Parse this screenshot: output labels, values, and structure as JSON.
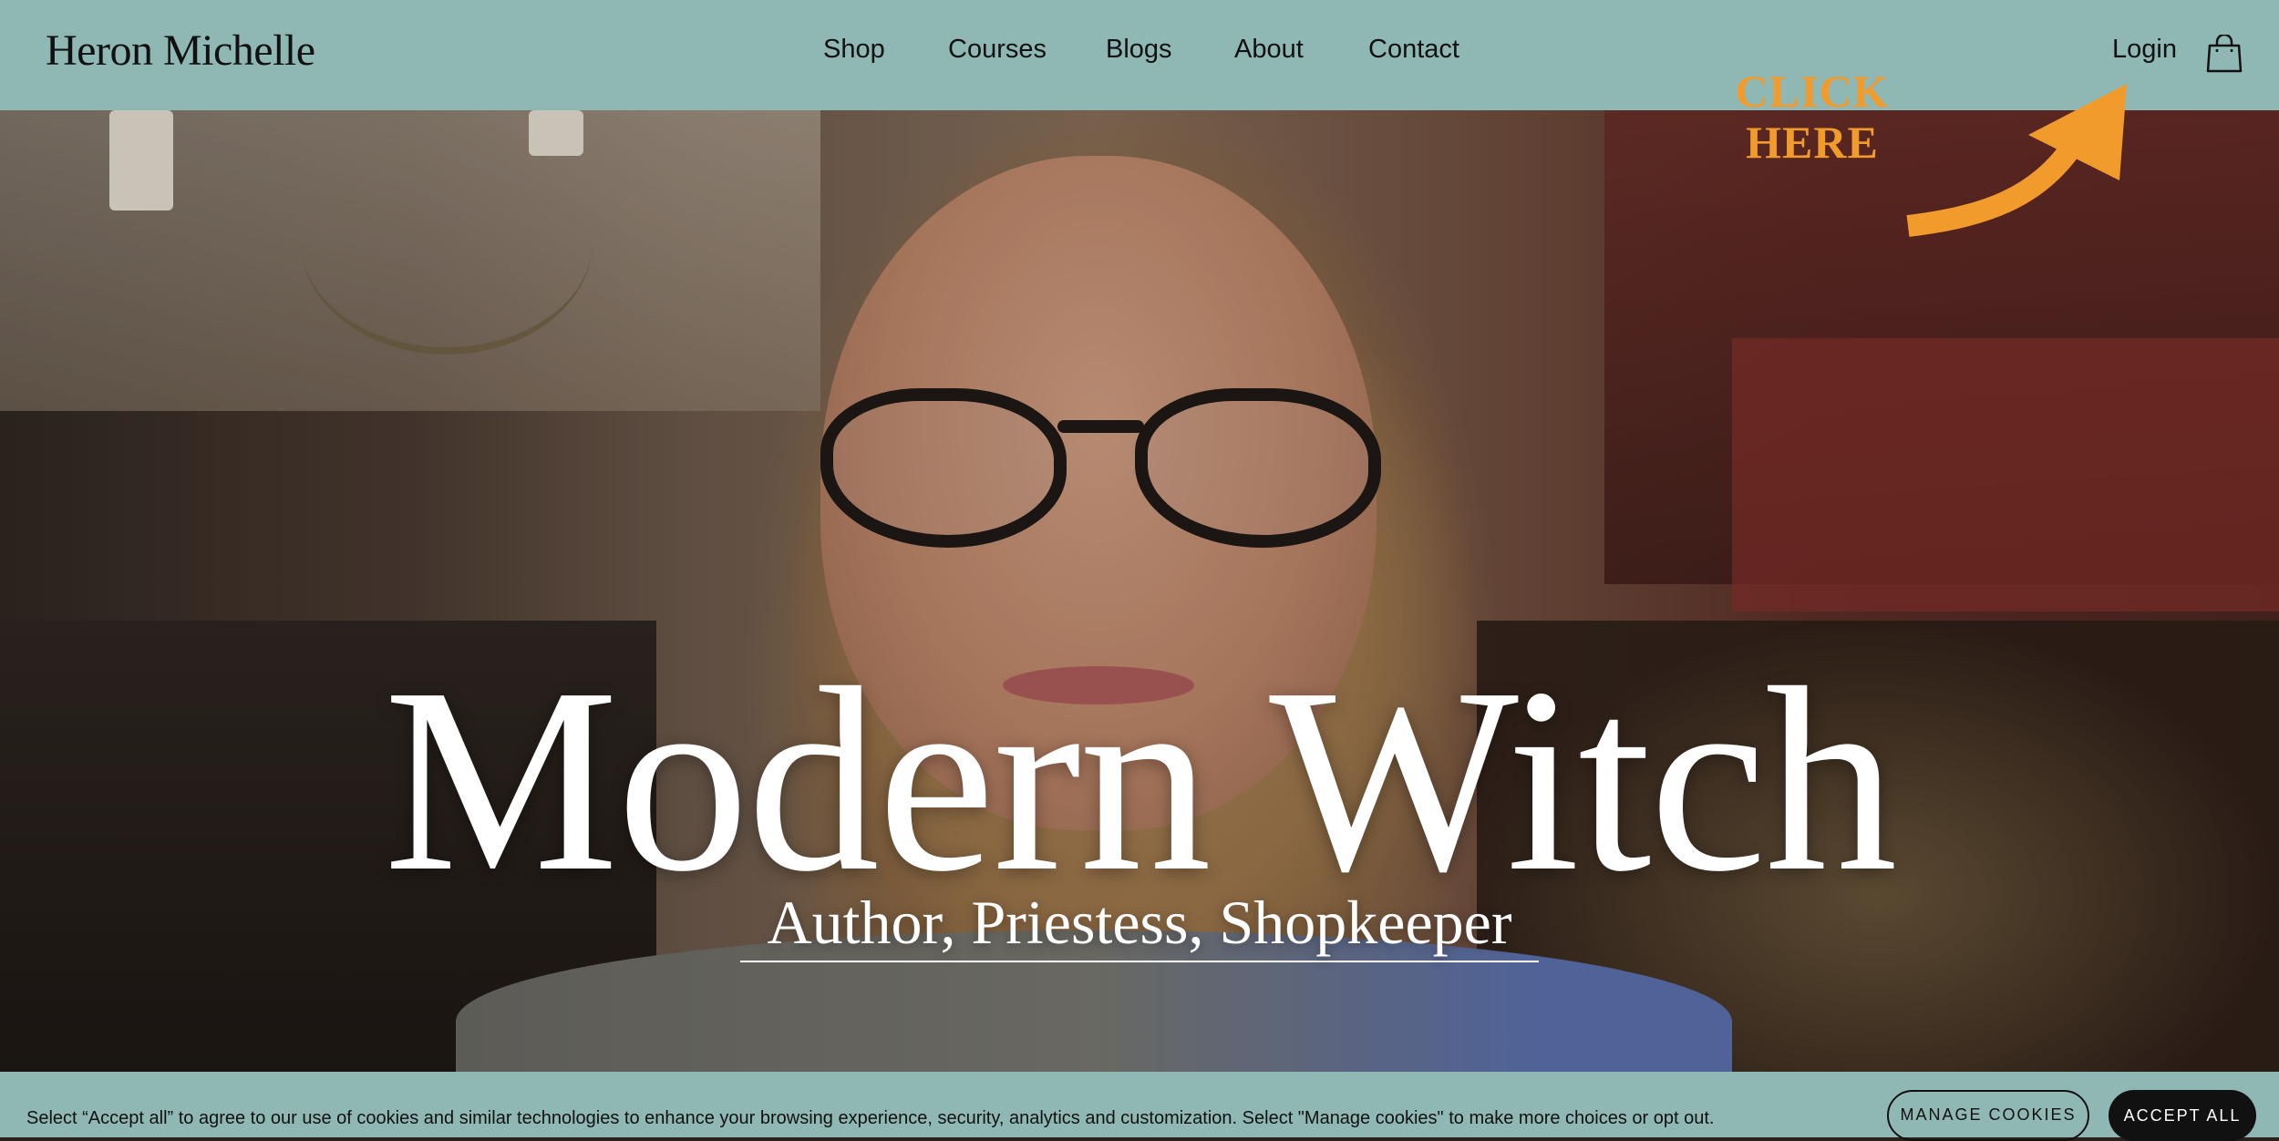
{
  "header": {
    "brand": "Heron Michelle",
    "nav": [
      {
        "label": "Shop"
      },
      {
        "label": "Courses"
      },
      {
        "label": "Blogs"
      },
      {
        "label": "About"
      },
      {
        "label": "Contact"
      }
    ],
    "login_label": "Login",
    "cart_icon": "shopping-bag-icon"
  },
  "hero": {
    "title": "Modern Witch",
    "subtitle": "Author, Priestess, Shopkeeper"
  },
  "callout": {
    "line1": "CLICK",
    "line2": "HERE",
    "color": "#f29b2d",
    "icon": "curved-arrow-icon"
  },
  "cookie_banner": {
    "text": "Select “Accept all” to agree to our use of cookies and similar technologies to enhance your browsing experience, security, analytics and customization. Select \"Manage cookies\" to make more choices or opt out.",
    "manage_label": "MANAGE COOKIES",
    "accept_label": "ACCEPT ALL"
  },
  "colors": {
    "header_bg": "#8fb8b5",
    "text": "#111111",
    "accent": "#f29b2d"
  }
}
